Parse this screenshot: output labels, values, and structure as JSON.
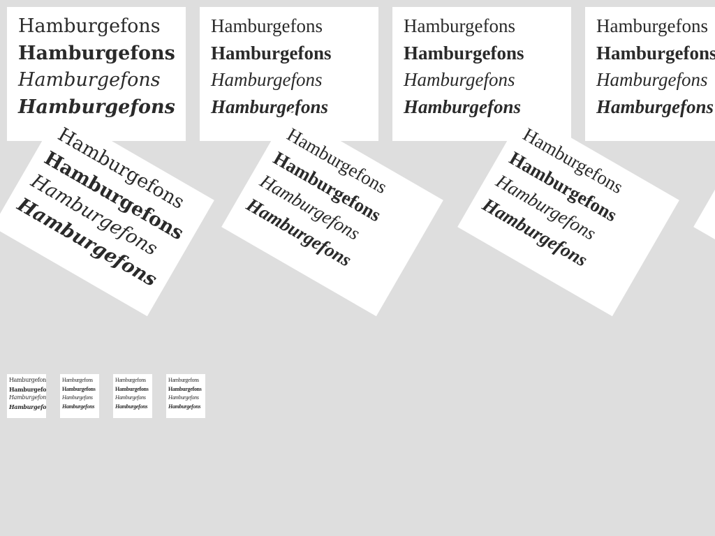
{
  "sample_lines": {
    "regular": "Hamburgefons",
    "bold": "Hamburgefons",
    "italic": "Hamburgefons",
    "bold_italic": "Hamburgefons"
  },
  "colors": {
    "background": "#dedede",
    "card": "#ffffff",
    "text": "#2a2a2a"
  },
  "rotated_angle_deg": 30
}
